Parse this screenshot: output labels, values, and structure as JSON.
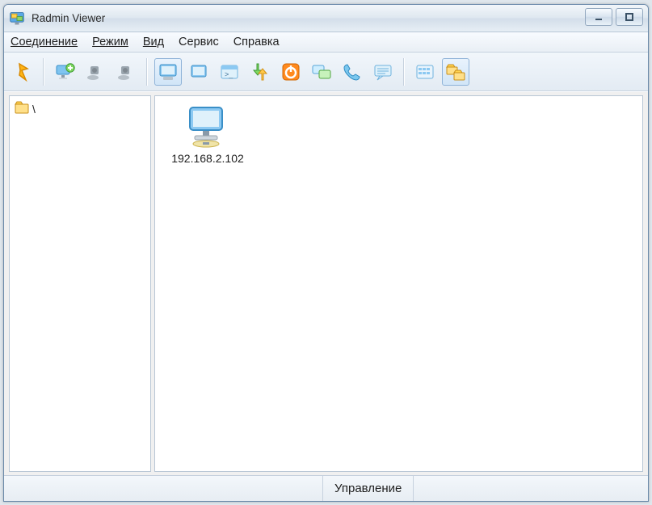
{
  "titlebar": {
    "title": "Radmin Viewer"
  },
  "menu": {
    "connection": "Соединение",
    "mode": "Режим",
    "view": "Вид",
    "service": "Сервис",
    "help": "Справка"
  },
  "toolbar": {
    "connect": "connect",
    "add_computer": "add-computer",
    "scan1": "scan",
    "scan2": "scan",
    "full_control": "full-control",
    "view_only": "view-only",
    "cmd": "cmd",
    "file_transfer": "file-transfer",
    "shutdown": "shutdown",
    "telnet": "telnet",
    "phone": "phone",
    "chat": "chat",
    "properties": "properties",
    "tree_toggle": "tree"
  },
  "tree": {
    "root_label": "\\"
  },
  "list": {
    "items": [
      {
        "label": "192.168.2.102"
      }
    ]
  },
  "status": {
    "mode": "Управление"
  },
  "icons": {
    "folder": "folder-icon"
  }
}
